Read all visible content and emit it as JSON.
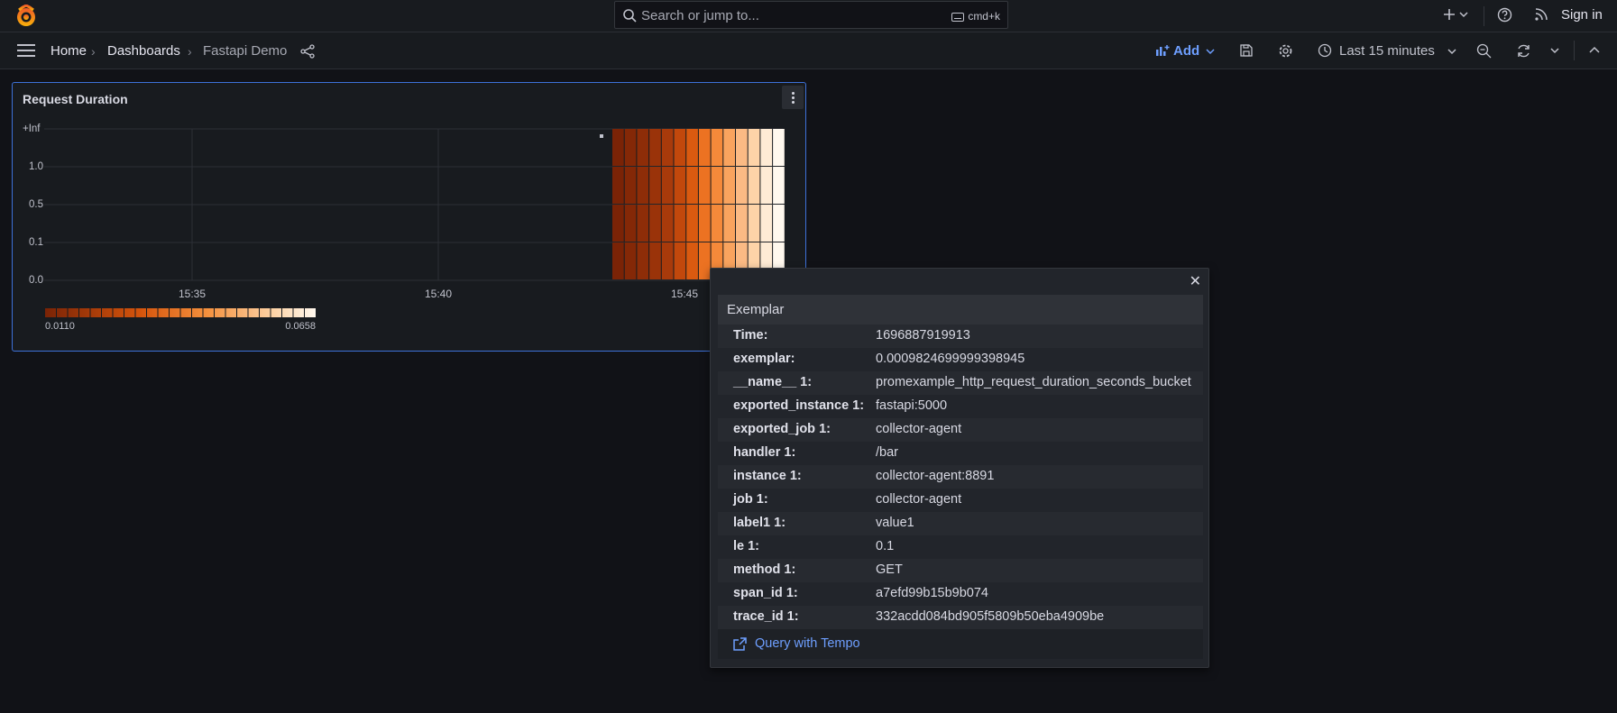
{
  "search": {
    "placeholder": "Search or jump to...",
    "shortcut": "cmd+k"
  },
  "topbar": {
    "sign_in": "Sign in"
  },
  "breadcrumb": {
    "home": "Home",
    "dashboards": "Dashboards",
    "current": "Fastapi Demo"
  },
  "toolbar": {
    "add_label": "Add",
    "time_range": "Last 15 minutes"
  },
  "panel": {
    "title": "Request Duration",
    "y_ticks": [
      "+Inf",
      "1.0",
      "0.5",
      "0.1",
      "0.0"
    ],
    "x_ticks": [
      "15:35",
      "15:40",
      "15:45"
    ],
    "legend_min": "0.0110",
    "legend_max": "0.0658"
  },
  "colors": {
    "accent": "#6e9fff",
    "panel_border": "#3d71d9",
    "heat_dark": "#7a2306",
    "heat_light": "#fff8ee"
  },
  "exemplar": {
    "title": "Exemplar",
    "rows": [
      {
        "key": "Time:",
        "value": "1696887919913"
      },
      {
        "key": "exemplar:",
        "value": "0.0009824699999398945"
      },
      {
        "key": "__name__ 1:",
        "value": "promexample_http_request_duration_seconds_bucket"
      },
      {
        "key": "exported_instance 1:",
        "value": "fastapi:5000"
      },
      {
        "key": "exported_job 1:",
        "value": "collector-agent"
      },
      {
        "key": "handler 1:",
        "value": "/bar"
      },
      {
        "key": "instance 1:",
        "value": "collector-agent:8891"
      },
      {
        "key": "job 1:",
        "value": "collector-agent"
      },
      {
        "key": "label1 1:",
        "value": "value1"
      },
      {
        "key": "le 1:",
        "value": "0.1"
      },
      {
        "key": "method 1:",
        "value": "GET"
      },
      {
        "key": "span_id 1:",
        "value": "a7efd99b15b9b074"
      },
      {
        "key": "trace_id 1:",
        "value": "332acdd084bd905f5809b50eba4909be"
      }
    ],
    "link_label": "Query with Tempo"
  }
}
